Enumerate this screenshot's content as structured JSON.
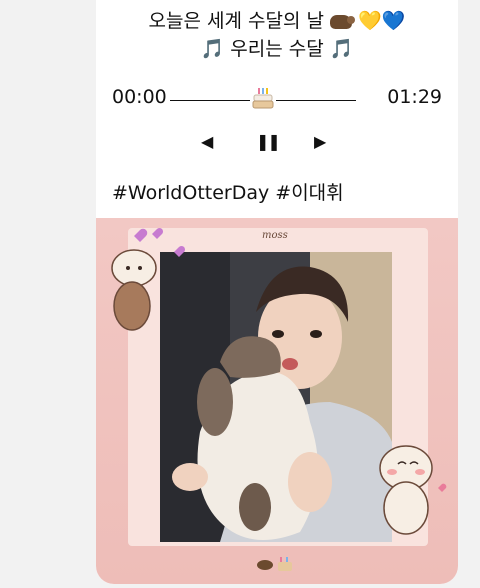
{
  "post": {
    "line1_text": "오늘은 세계 수달의 날",
    "line1_emoji_otter": "otter-emoji",
    "line1_heart1": "💛",
    "line1_heart2": "💙",
    "line2_note_left": "🎵",
    "line2_text": "우리는 수달",
    "line2_note_right": "🎵",
    "hashtags": "#WorldOtterDay #이대휘"
  },
  "player": {
    "time_start": "00:00",
    "time_end": "01:29",
    "progress_fraction": 0.5,
    "scrubber_icon": "birthday-cake-icon",
    "prev_symbol": "◀",
    "pause_symbol": "❚❚",
    "next_symbol": "▶"
  },
  "media": {
    "sticker_label": "moss",
    "bottom_emoji_icons": [
      "otter-emoji",
      "birthday-cake-icon"
    ]
  },
  "colors": {
    "background": "#f2f2f2",
    "card": "#ffffff",
    "media_pink": "#f2c8c4",
    "heart_yellow": "#f2c31b",
    "heart_blue": "#2f6fe0",
    "otter_brown": "#6b4a2e"
  }
}
